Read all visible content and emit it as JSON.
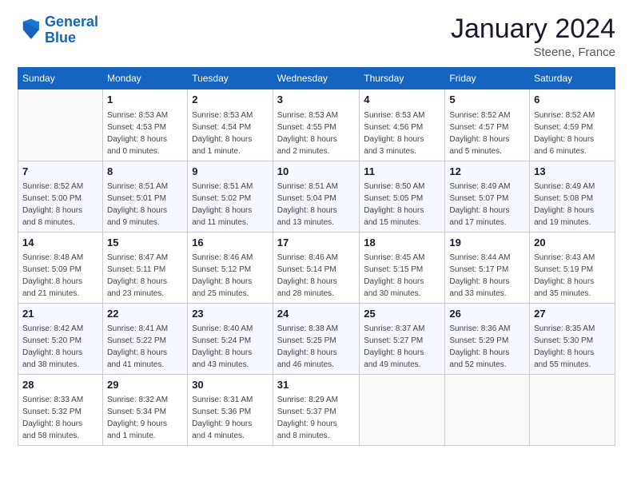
{
  "logo": {
    "line1": "General",
    "line2": "Blue"
  },
  "header": {
    "month": "January 2024",
    "location": "Steene, France"
  },
  "weekdays": [
    "Sunday",
    "Monday",
    "Tuesday",
    "Wednesday",
    "Thursday",
    "Friday",
    "Saturday"
  ],
  "weeks": [
    [
      {
        "day": "",
        "sunrise": "",
        "sunset": "",
        "daylight": "",
        "empty": true
      },
      {
        "day": "1",
        "sunrise": "Sunrise: 8:53 AM",
        "sunset": "Sunset: 4:53 PM",
        "daylight": "Daylight: 8 hours and 0 minutes."
      },
      {
        "day": "2",
        "sunrise": "Sunrise: 8:53 AM",
        "sunset": "Sunset: 4:54 PM",
        "daylight": "Daylight: 8 hours and 1 minute."
      },
      {
        "day": "3",
        "sunrise": "Sunrise: 8:53 AM",
        "sunset": "Sunset: 4:55 PM",
        "daylight": "Daylight: 8 hours and 2 minutes."
      },
      {
        "day": "4",
        "sunrise": "Sunrise: 8:53 AM",
        "sunset": "Sunset: 4:56 PM",
        "daylight": "Daylight: 8 hours and 3 minutes."
      },
      {
        "day": "5",
        "sunrise": "Sunrise: 8:52 AM",
        "sunset": "Sunset: 4:57 PM",
        "daylight": "Daylight: 8 hours and 5 minutes."
      },
      {
        "day": "6",
        "sunrise": "Sunrise: 8:52 AM",
        "sunset": "Sunset: 4:59 PM",
        "daylight": "Daylight: 8 hours and 6 minutes."
      }
    ],
    [
      {
        "day": "7",
        "sunrise": "Sunrise: 8:52 AM",
        "sunset": "Sunset: 5:00 PM",
        "daylight": "Daylight: 8 hours and 8 minutes."
      },
      {
        "day": "8",
        "sunrise": "Sunrise: 8:51 AM",
        "sunset": "Sunset: 5:01 PM",
        "daylight": "Daylight: 8 hours and 9 minutes."
      },
      {
        "day": "9",
        "sunrise": "Sunrise: 8:51 AM",
        "sunset": "Sunset: 5:02 PM",
        "daylight": "Daylight: 8 hours and 11 minutes."
      },
      {
        "day": "10",
        "sunrise": "Sunrise: 8:51 AM",
        "sunset": "Sunset: 5:04 PM",
        "daylight": "Daylight: 8 hours and 13 minutes."
      },
      {
        "day": "11",
        "sunrise": "Sunrise: 8:50 AM",
        "sunset": "Sunset: 5:05 PM",
        "daylight": "Daylight: 8 hours and 15 minutes."
      },
      {
        "day": "12",
        "sunrise": "Sunrise: 8:49 AM",
        "sunset": "Sunset: 5:07 PM",
        "daylight": "Daylight: 8 hours and 17 minutes."
      },
      {
        "day": "13",
        "sunrise": "Sunrise: 8:49 AM",
        "sunset": "Sunset: 5:08 PM",
        "daylight": "Daylight: 8 hours and 19 minutes."
      }
    ],
    [
      {
        "day": "14",
        "sunrise": "Sunrise: 8:48 AM",
        "sunset": "Sunset: 5:09 PM",
        "daylight": "Daylight: 8 hours and 21 minutes."
      },
      {
        "day": "15",
        "sunrise": "Sunrise: 8:47 AM",
        "sunset": "Sunset: 5:11 PM",
        "daylight": "Daylight: 8 hours and 23 minutes."
      },
      {
        "day": "16",
        "sunrise": "Sunrise: 8:46 AM",
        "sunset": "Sunset: 5:12 PM",
        "daylight": "Daylight: 8 hours and 25 minutes."
      },
      {
        "day": "17",
        "sunrise": "Sunrise: 8:46 AM",
        "sunset": "Sunset: 5:14 PM",
        "daylight": "Daylight: 8 hours and 28 minutes."
      },
      {
        "day": "18",
        "sunrise": "Sunrise: 8:45 AM",
        "sunset": "Sunset: 5:15 PM",
        "daylight": "Daylight: 8 hours and 30 minutes."
      },
      {
        "day": "19",
        "sunrise": "Sunrise: 8:44 AM",
        "sunset": "Sunset: 5:17 PM",
        "daylight": "Daylight: 8 hours and 33 minutes."
      },
      {
        "day": "20",
        "sunrise": "Sunrise: 8:43 AM",
        "sunset": "Sunset: 5:19 PM",
        "daylight": "Daylight: 8 hours and 35 minutes."
      }
    ],
    [
      {
        "day": "21",
        "sunrise": "Sunrise: 8:42 AM",
        "sunset": "Sunset: 5:20 PM",
        "daylight": "Daylight: 8 hours and 38 minutes."
      },
      {
        "day": "22",
        "sunrise": "Sunrise: 8:41 AM",
        "sunset": "Sunset: 5:22 PM",
        "daylight": "Daylight: 8 hours and 41 minutes."
      },
      {
        "day": "23",
        "sunrise": "Sunrise: 8:40 AM",
        "sunset": "Sunset: 5:24 PM",
        "daylight": "Daylight: 8 hours and 43 minutes."
      },
      {
        "day": "24",
        "sunrise": "Sunrise: 8:38 AM",
        "sunset": "Sunset: 5:25 PM",
        "daylight": "Daylight: 8 hours and 46 minutes."
      },
      {
        "day": "25",
        "sunrise": "Sunrise: 8:37 AM",
        "sunset": "Sunset: 5:27 PM",
        "daylight": "Daylight: 8 hours and 49 minutes."
      },
      {
        "day": "26",
        "sunrise": "Sunrise: 8:36 AM",
        "sunset": "Sunset: 5:29 PM",
        "daylight": "Daylight: 8 hours and 52 minutes."
      },
      {
        "day": "27",
        "sunrise": "Sunrise: 8:35 AM",
        "sunset": "Sunset: 5:30 PM",
        "daylight": "Daylight: 8 hours and 55 minutes."
      }
    ],
    [
      {
        "day": "28",
        "sunrise": "Sunrise: 8:33 AM",
        "sunset": "Sunset: 5:32 PM",
        "daylight": "Daylight: 8 hours and 58 minutes."
      },
      {
        "day": "29",
        "sunrise": "Sunrise: 8:32 AM",
        "sunset": "Sunset: 5:34 PM",
        "daylight": "Daylight: 9 hours and 1 minute."
      },
      {
        "day": "30",
        "sunrise": "Sunrise: 8:31 AM",
        "sunset": "Sunset: 5:36 PM",
        "daylight": "Daylight: 9 hours and 4 minutes."
      },
      {
        "day": "31",
        "sunrise": "Sunrise: 8:29 AM",
        "sunset": "Sunset: 5:37 PM",
        "daylight": "Daylight: 9 hours and 8 minutes."
      },
      {
        "day": "",
        "sunrise": "",
        "sunset": "",
        "daylight": "",
        "empty": true
      },
      {
        "day": "",
        "sunrise": "",
        "sunset": "",
        "daylight": "",
        "empty": true
      },
      {
        "day": "",
        "sunrise": "",
        "sunset": "",
        "daylight": "",
        "empty": true
      }
    ]
  ]
}
